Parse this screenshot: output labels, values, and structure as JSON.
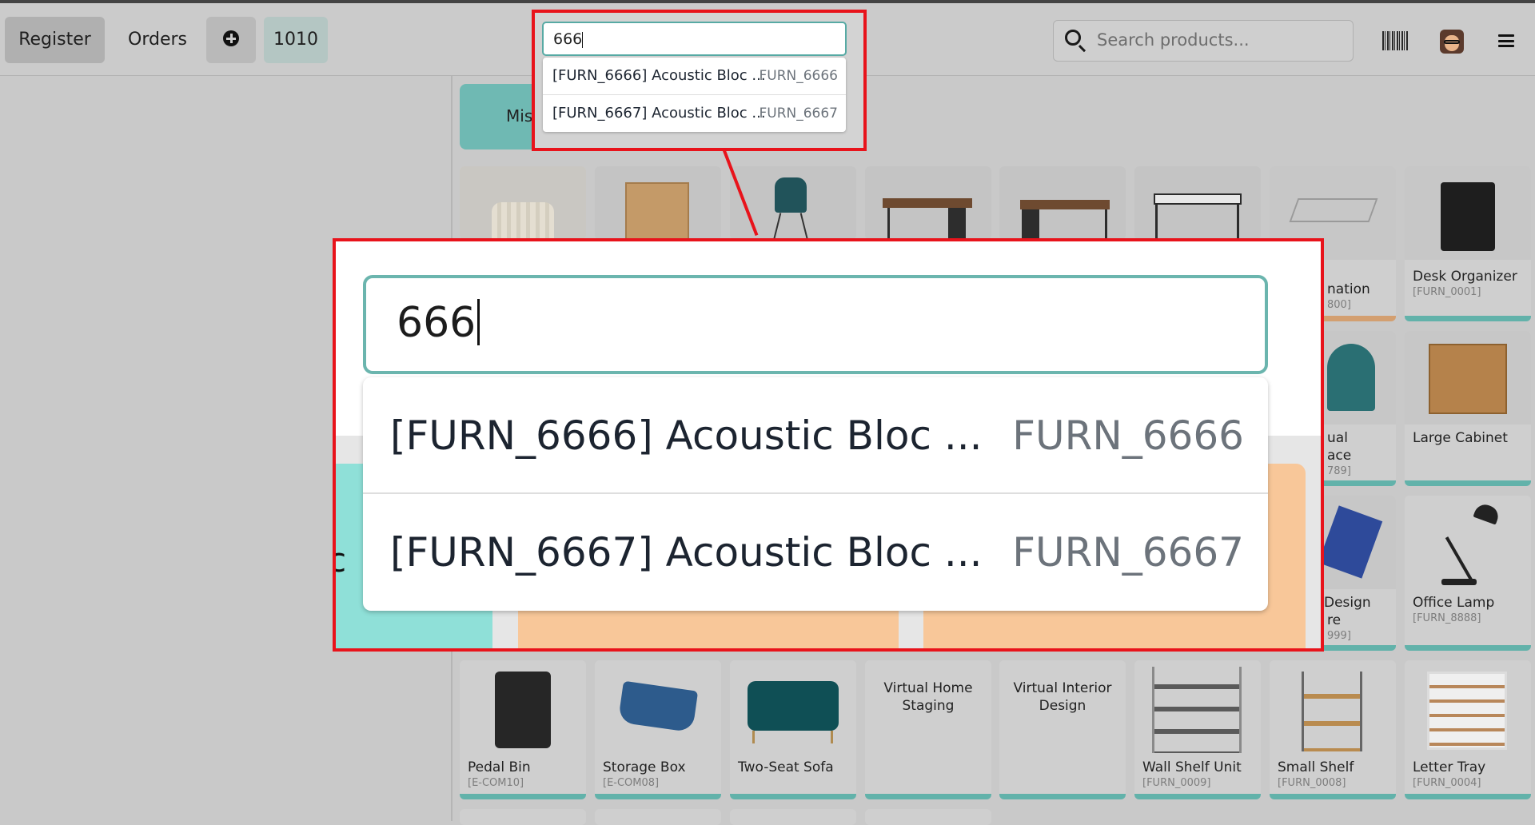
{
  "topbar": {
    "register": "Register",
    "orders": "Orders",
    "order_number": "1010",
    "search_placeholder": "Search products..."
  },
  "categories": {
    "misc": "Misc"
  },
  "search_popup": {
    "query": "666",
    "results": [
      {
        "label": "[FURN_6666] Acoustic Bloc ...",
        "code": "FURN_6666"
      },
      {
        "label": "[FURN_6667] Acoustic Bloc ...",
        "code": "FURN_6667"
      }
    ]
  },
  "zoom": {
    "query": "666",
    "results": [
      {
        "label": "[FURN_6666] Acoustic Bloc ...",
        "code": "FURN_6666"
      },
      {
        "label": "[FURN_6667] Acoustic Bloc ...",
        "code": "FURN_6667"
      }
    ],
    "tile_fragment": "c"
  },
  "products_partial": [
    {
      "name": "nation",
      "ref": "800]"
    },
    {
      "name": "ual",
      "name2": "ace",
      "ref": "789]"
    },
    {
      "name": "Design",
      "name2": "re",
      "ref": "999]"
    }
  ],
  "products_right": [
    {
      "name": "Desk Organizer",
      "ref": "[FURN_0001]"
    },
    {
      "name": "Large Cabinet",
      "ref": ""
    },
    {
      "name": "Office Lamp",
      "ref": "[FURN_8888]"
    }
  ],
  "products_bottom": [
    {
      "name": "Pedal Bin",
      "ref": "[E-COM10]"
    },
    {
      "name": "Storage Box",
      "ref": "[E-COM08]"
    },
    {
      "name": "Two-Seat Sofa",
      "ref": ""
    },
    {
      "name": "Virtual Home Staging",
      "ref": ""
    },
    {
      "name": "Virtual Interior Design",
      "ref": ""
    },
    {
      "name": "Wall Shelf Unit",
      "ref": "[FURN_0009]"
    },
    {
      "name": "Small Shelf",
      "ref": "[FURN_0008]"
    },
    {
      "name": "Letter Tray",
      "ref": "[FURN_0004]"
    }
  ],
  "colors": {
    "accent_teal": "#62b2aa",
    "highlight_red": "#e8131b",
    "category_orange": "#f8c799"
  }
}
